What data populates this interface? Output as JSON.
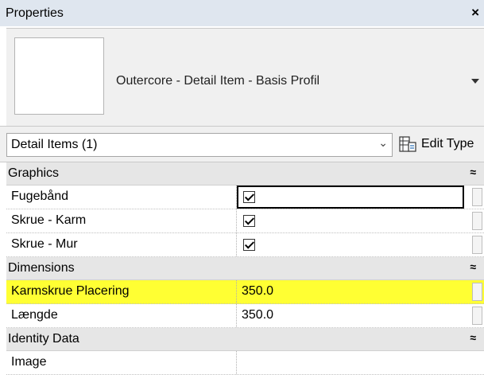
{
  "window": {
    "title": "Properties",
    "close_icon": "×"
  },
  "type_selector": {
    "name": "Outercore - Detail Item - Basis Profil"
  },
  "filter": {
    "label": "Detail Items (1)",
    "chevron": "⌄"
  },
  "edit_type": {
    "label": "Edit Type"
  },
  "groups": [
    {
      "name": "Graphics",
      "collapse_glyph": "≈",
      "rows": [
        {
          "name": "Fugebånd",
          "checked": true
        },
        {
          "name": "Skrue - Karm",
          "checked": true
        },
        {
          "name": "Skrue - Mur",
          "checked": true
        }
      ]
    },
    {
      "name": "Dimensions",
      "collapse_glyph": "≈",
      "rows": [
        {
          "name": "Karmskrue Placering",
          "value": "350.0"
        },
        {
          "name": "Længde",
          "value": "350.0"
        }
      ]
    },
    {
      "name": "Identity Data",
      "collapse_glyph": "≈",
      "rows": [
        {
          "name": "Image",
          "value": ""
        }
      ]
    }
  ],
  "colors": {
    "highlight": "#ffff33",
    "titlebar": "#dfe6ef",
    "group_header": "#e6e6e6"
  }
}
